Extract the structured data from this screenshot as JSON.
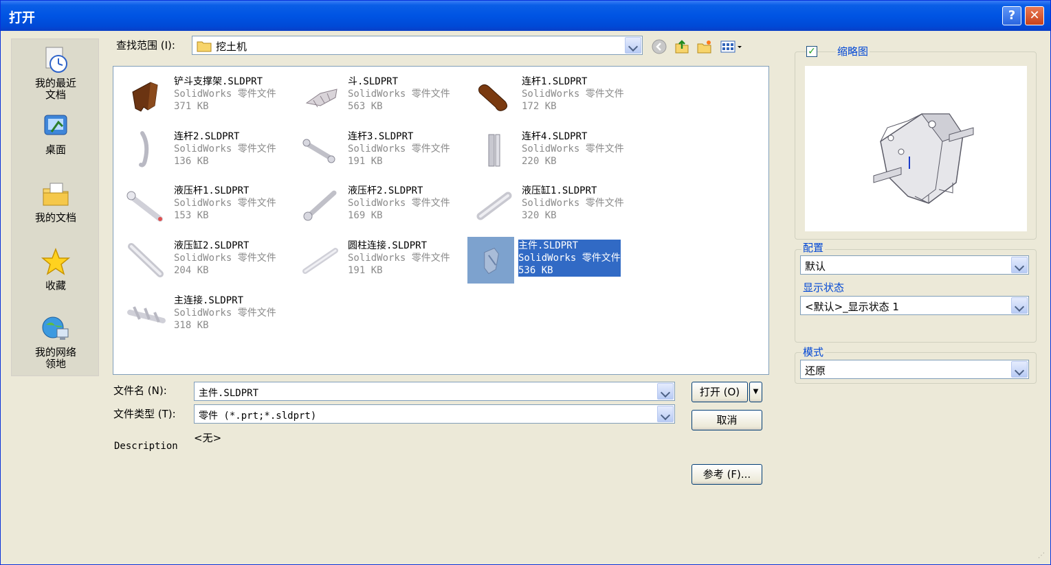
{
  "window": {
    "title": "打开",
    "help_label": "?",
    "close_label": "✕"
  },
  "places": [
    {
      "label": "我的最近\n文档",
      "icon": "recent-documents-icon"
    },
    {
      "label": "桌面",
      "icon": "desktop-icon"
    },
    {
      "label": "我的文档",
      "icon": "my-documents-icon"
    },
    {
      "label": "收藏",
      "icon": "favorites-star-icon"
    },
    {
      "label": "我的网络\n领地",
      "icon": "network-places-icon"
    }
  ],
  "lookin": {
    "label": "查找范围 (I):",
    "value": "挖土机",
    "icon": "folder-icon"
  },
  "toolbar": {
    "back": "back-icon",
    "up": "up-folder-icon",
    "new_folder": "new-folder-icon",
    "views": "view-menu-icon"
  },
  "files": [
    {
      "name": "铲斗支撑架.SLDPRT",
      "type": "SolidWorks 零件文件",
      "size": "371 KB",
      "selected": false
    },
    {
      "name": "斗.SLDPRT",
      "type": "SolidWorks 零件文件",
      "size": "563 KB",
      "selected": false
    },
    {
      "name": "连杆1.SLDPRT",
      "type": "SolidWorks 零件文件",
      "size": "172 KB",
      "selected": false
    },
    {
      "name": "连杆2.SLDPRT",
      "type": "SolidWorks 零件文件",
      "size": "136 KB",
      "selected": false
    },
    {
      "name": "连杆3.SLDPRT",
      "type": "SolidWorks 零件文件",
      "size": "191 KB",
      "selected": false
    },
    {
      "name": "连杆4.SLDPRT",
      "type": "SolidWorks 零件文件",
      "size": "220 KB",
      "selected": false
    },
    {
      "name": "液压杆1.SLDPRT",
      "type": "SolidWorks 零件文件",
      "size": "153 KB",
      "selected": false
    },
    {
      "name": "液压杆2.SLDPRT",
      "type": "SolidWorks 零件文件",
      "size": "169 KB",
      "selected": false
    },
    {
      "name": "液压缸1.SLDPRT",
      "type": "SolidWorks 零件文件",
      "size": "320 KB",
      "selected": false
    },
    {
      "name": "液压缸2.SLDPRT",
      "type": "SolidWorks 零件文件",
      "size": "204 KB",
      "selected": false
    },
    {
      "name": "圆柱连接.SLDPRT",
      "type": "SolidWorks 零件文件",
      "size": "191 KB",
      "selected": false
    },
    {
      "name": "主件.SLDPRT",
      "type": "SolidWorks 零件文件",
      "size": "536 KB",
      "selected": true
    },
    {
      "name": "主连接.SLDPRT",
      "type": "SolidWorks 零件文件",
      "size": "318 KB",
      "selected": false
    }
  ],
  "filename": {
    "label": "文件名 (N):",
    "value": "主件.SLDPRT"
  },
  "filetype": {
    "label": "文件类型 (T):",
    "value": "零件 (*.prt;*.sldprt)"
  },
  "description": {
    "label": "Description",
    "value": "<无>"
  },
  "buttons": {
    "open": "打开 (O)",
    "cancel": "取消",
    "references": "参考 (F)..."
  },
  "right": {
    "thumbnail_label": "缩略图",
    "thumbnail_checked": true,
    "config_label": "配置",
    "config_value": "默认",
    "display_state_label": "显示状态",
    "display_state_value": "<默认>_显示状态 1",
    "mode_label": "模式",
    "mode_value": "还原"
  }
}
